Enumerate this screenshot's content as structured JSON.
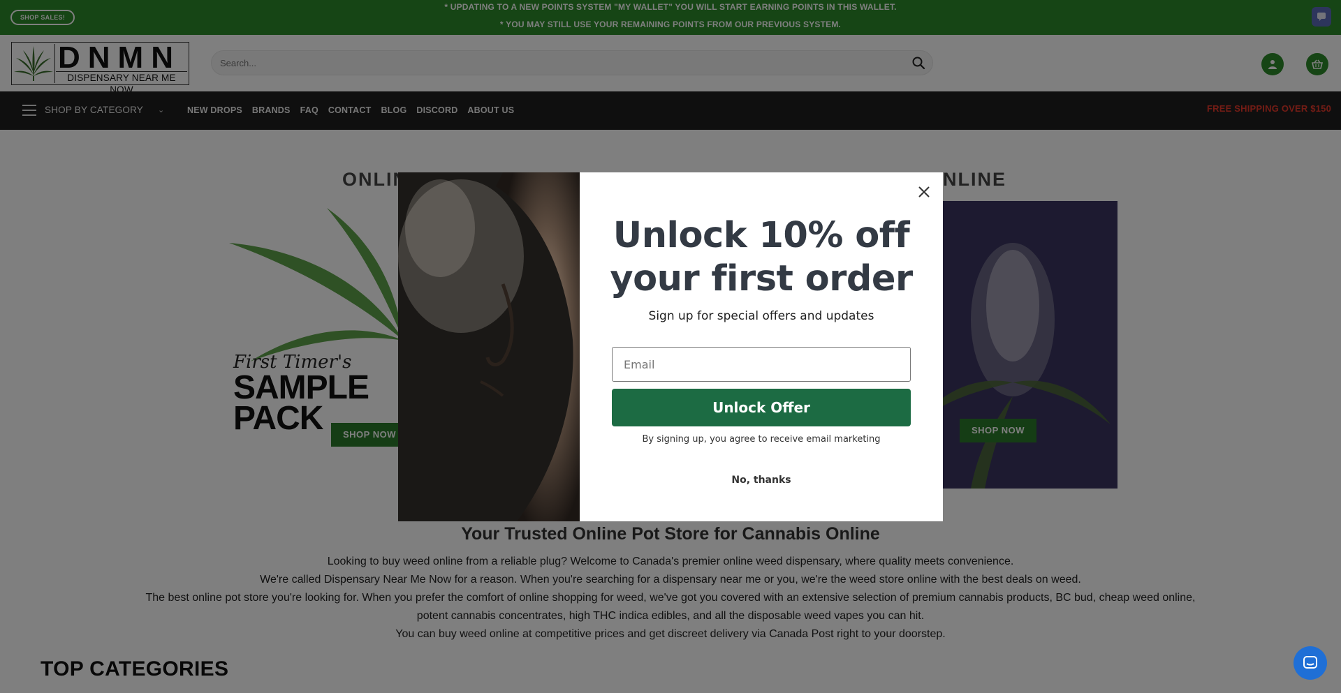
{
  "topbar": {
    "shop_sales": "SHOP SALES!",
    "announce_1": "* UPDATING TO A NEW POINTS SYSTEM \"MY WALLET\" YOU WILL START EARNING POINTS IN THIS WALLET.",
    "announce_2": "* YOU MAY STILL USE YOUR REMAINING POINTS FROM OUR PREVIOUS SYSTEM.",
    "badge_icon": "chat-bubble-icon"
  },
  "header": {
    "logo_title": "DNMN",
    "logo_sub": "DISPENSARY NEAR ME NOW",
    "search_placeholder": "Search...",
    "account_icon": "user-icon",
    "cart_icon": "basket-icon"
  },
  "nav": {
    "category_label": "SHOP BY CATEGORY",
    "links": [
      "NEW DROPS",
      "BRANDS",
      "FAQ",
      "CONTACT",
      "BLOG",
      "DISCORD",
      "ABOUT US"
    ],
    "free_shipping": "FREE SHIPPING OVER $150"
  },
  "main": {
    "hero_left_visible": "ONLIN",
    "hero_right_visible": "NLINE",
    "sample_line1": "First Timer's",
    "sample_line2": "SAMPLE",
    "sample_line3": "PACK",
    "shop_now_left": "SHOP NOW",
    "shop_now_right": "SHOP NOW",
    "section_title": "Your Trusted Online Pot Store for Cannabis Online",
    "paragraphs": [
      "Looking to buy weed online from a reliable plug? Welcome to Canada's premier online weed dispensary, where quality meets convenience.",
      "We're called Dispensary Near Me Now for a reason. When you're searching for a dispensary near me or you, we're the weed store online with the best deals on weed.",
      "The best online pot store you're looking for. When you prefer the comfort of online shopping for weed, we've got you covered with an extensive selection of premium cannabis products, BC bud, cheap weed online,",
      "potent cannabis concentrates, high THC indica edibles, and all the disposable weed vapes you can hit.",
      "You can buy weed online at competitive prices and get discreet delivery via Canada Post right to your doorstep."
    ],
    "top_categories": "TOP CATEGORIES"
  },
  "modal": {
    "headline_1": "Unlock 10% off",
    "headline_2": "your first order",
    "subtitle": "Sign up for special offers and updates",
    "email_placeholder": "Email",
    "cta": "Unlock Offer",
    "consent": "By signing up, you agree to receive email marketing",
    "decline": "No, thanks",
    "close_icon": "close-icon"
  },
  "colors": {
    "brand_green": "#2d8a2a",
    "cta_green": "#1c6b43",
    "shipping_red": "#e8392b",
    "nav_bg": "#1e1e1e"
  }
}
